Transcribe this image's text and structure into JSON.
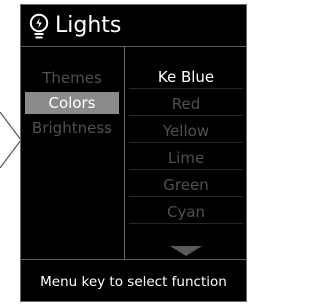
{
  "header": {
    "title": "Lights",
    "icon": "lightbulb-icon"
  },
  "left_menu": {
    "items": [
      {
        "label": "Themes",
        "state": "dim"
      },
      {
        "label": "Colors",
        "state": "selected"
      },
      {
        "label": "Brightness",
        "state": "dim"
      }
    ]
  },
  "right_menu": {
    "items": [
      {
        "label": "Ke Blue",
        "state": "highlighted"
      },
      {
        "label": "Red",
        "state": "dim"
      },
      {
        "label": "Yellow",
        "state": "dim"
      },
      {
        "label": "Lime",
        "state": "dim"
      },
      {
        "label": "Green",
        "state": "dim"
      },
      {
        "label": "Cyan",
        "state": "dim"
      }
    ],
    "more_indicator": "chevron-down-icon"
  },
  "footer": {
    "hint": "Menu key to select function"
  },
  "colors": {
    "background": "#000000",
    "selected_bg": "#8a8a8a",
    "dim_text": "#505050",
    "bright_text": "#ffffff"
  }
}
